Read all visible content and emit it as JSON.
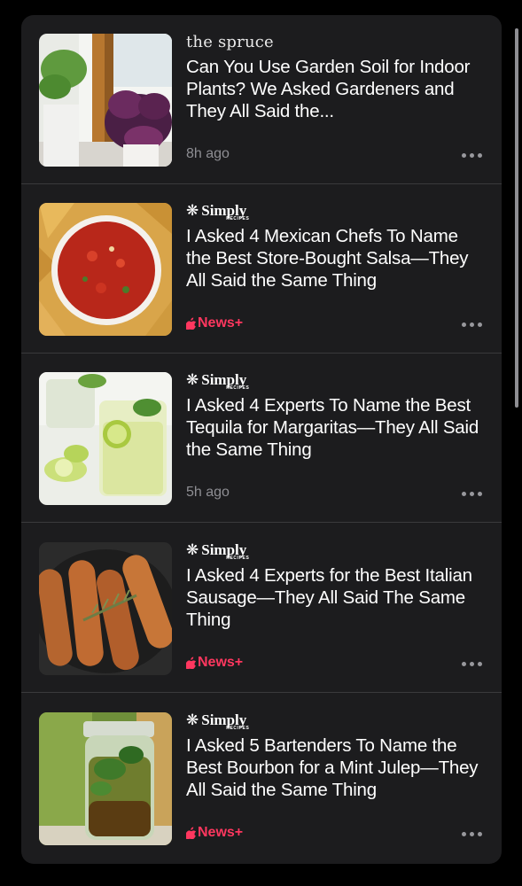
{
  "colors": {
    "background": "#000000",
    "card": "#1c1c1e",
    "divider": "#3a3a3c",
    "headline": "#ffffff",
    "meta": "#8e8e93",
    "news_plus": "#ff375f"
  },
  "articles": [
    {
      "publisher": "the spruce",
      "headline": "Can You Use Garden Soil for Indoor Plants? We Asked Gardeners and They All Said the...",
      "meta": "8h ago",
      "thumbnail": "houseplants-window-image"
    },
    {
      "publisher": "Simply",
      "publisher_sub": "RECIPES",
      "headline": "I Asked 4 Mexican Chefs To Name the Best Store-Bought Salsa—They All Said the Same Thing",
      "badge": "News+",
      "thumbnail": "salsa-bowl-image"
    },
    {
      "publisher": "Simply",
      "publisher_sub": "RECIPES",
      "headline": "I Asked 4 Experts To Name the Best Tequila for Margaritas—They All Said the Same Thing",
      "meta": "5h ago",
      "thumbnail": "margarita-glass-image"
    },
    {
      "publisher": "Simply",
      "publisher_sub": "RECIPES",
      "headline": "I Asked 4 Experts for the Best Italian Sausage—They All Said The Same Thing",
      "badge": "News+",
      "thumbnail": "sausage-pan-image"
    },
    {
      "publisher": "Simply",
      "publisher_sub": "RECIPES",
      "headline": "I Asked 5 Bartenders To Name the Best Bourbon for a Mint Julep—They All Said the Same Thing",
      "badge": "News+",
      "thumbnail": "mint-julep-image"
    }
  ]
}
